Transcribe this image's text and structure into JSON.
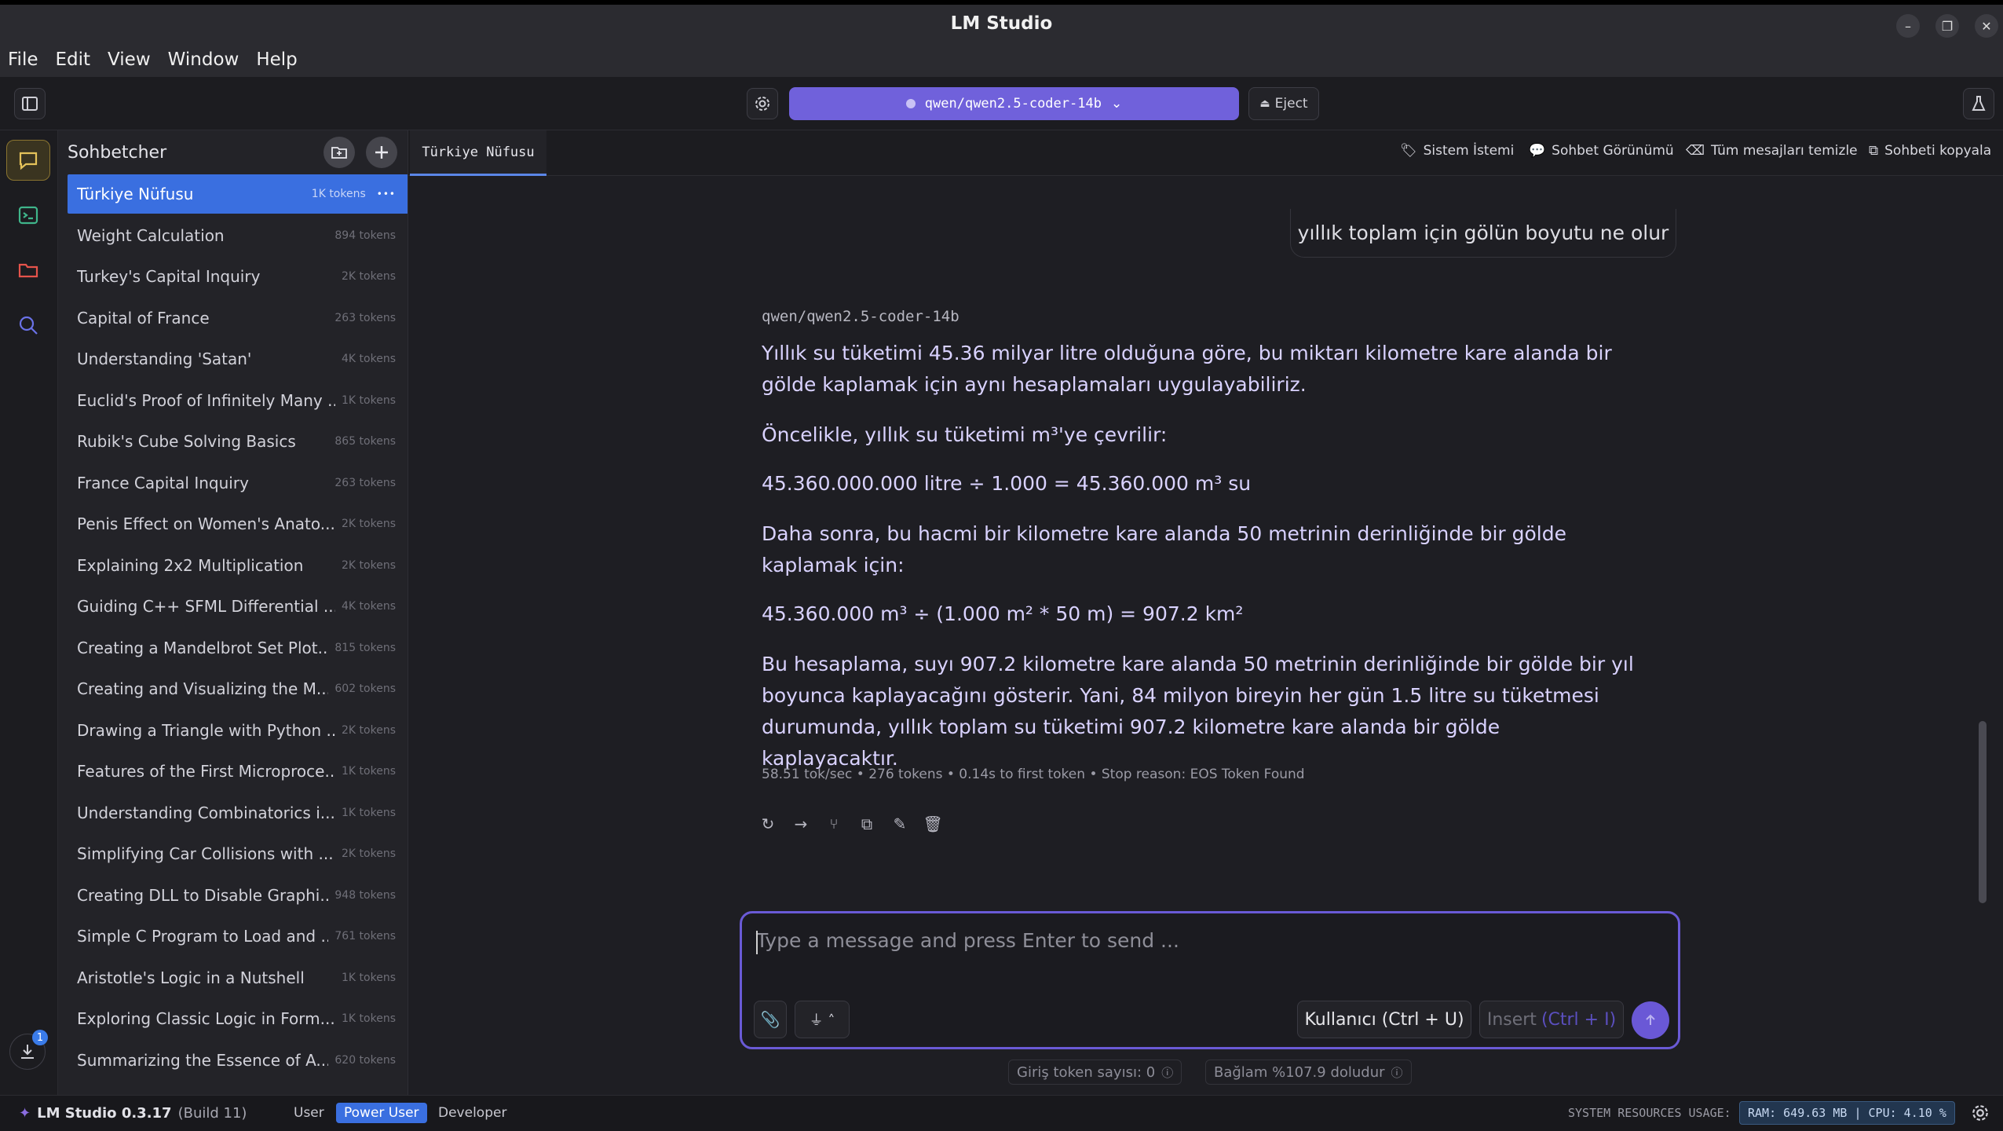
{
  "window": {
    "title": "LM Studio"
  },
  "menu": [
    "File",
    "Edit",
    "View",
    "Window",
    "Help"
  ],
  "toolbar": {
    "model": "qwen/qwen2.5-coder-14b",
    "eject_label": "Eject"
  },
  "sidebar": {
    "title": "Sohbetcher",
    "chats": [
      {
        "name": "Türkiye Nüfusu",
        "tokens": "1K tokens",
        "active": true
      },
      {
        "name": "Weight Calculation",
        "tokens": "894 tokens"
      },
      {
        "name": "Turkey's Capital Inquiry",
        "tokens": "2K tokens"
      },
      {
        "name": "Capital of France",
        "tokens": "263 tokens"
      },
      {
        "name": "Understanding 'Satan'",
        "tokens": "4K tokens"
      },
      {
        "name": "Euclid's Proof of Infinitely Many ...",
        "tokens": "1K tokens"
      },
      {
        "name": "Rubik's Cube Solving Basics",
        "tokens": "865 tokens"
      },
      {
        "name": "France Capital Inquiry",
        "tokens": "263 tokens"
      },
      {
        "name": "Penis Effect on Women's Anato...",
        "tokens": "2K tokens"
      },
      {
        "name": "Explaining 2x2 Multiplication",
        "tokens": "2K tokens"
      },
      {
        "name": "Guiding C++ SFML Differential ...",
        "tokens": "4K tokens"
      },
      {
        "name": "Creating a Mandelbrot Set Plot...",
        "tokens": "815 tokens"
      },
      {
        "name": "Creating and Visualizing the M...",
        "tokens": "602 tokens"
      },
      {
        "name": "Drawing a Triangle with Python ...",
        "tokens": "2K tokens"
      },
      {
        "name": "Features of the First Microproce...",
        "tokens": "1K tokens"
      },
      {
        "name": "Understanding Combinatorics i...",
        "tokens": "1K tokens"
      },
      {
        "name": "Simplifying Car Collisions with ...",
        "tokens": "2K tokens"
      },
      {
        "name": "Creating DLL to Disable Graphi...",
        "tokens": "948 tokens"
      },
      {
        "name": "Simple C Program to Load and ...",
        "tokens": "761 tokens"
      },
      {
        "name": "Aristotle's Logic in a Nutshell",
        "tokens": "1K tokens"
      },
      {
        "name": "Exploring Classic Logic in Form...",
        "tokens": "1K tokens"
      },
      {
        "name": "Summarizing the Essence of A...",
        "tokens": "620 tokens"
      }
    ]
  },
  "tabs": {
    "active": "Türkiye Nüfusu"
  },
  "tab_actions": {
    "system_prompt": "Sistem İstemi",
    "chat_view": "Sohbet Görünümü",
    "clear_all": "Tüm mesajları temizle",
    "copy_chat": "Sohbeti kopyala"
  },
  "conversation": {
    "user_message": "yıllık toplam için gölün boyutu ne olur",
    "model_tag": "qwen/qwen2.5-coder-14b",
    "paragraphs": [
      "Yıllık su tüketimi 45.36 milyar litre olduğuna göre, bu miktarı kilometre kare alanda bir gölde kaplamak için aynı hesaplamaları uygulayabiliriz.",
      "Öncelikle, yıllık su tüketimi m³'ye çevrilir:",
      "45.360.000.000 litre ÷ 1.000 = 45.360.000 m³ su",
      "Daha sonra, bu hacmi bir kilometre kare alanda 50 metrinin derinliğinde bir gölde kaplamak için:",
      "45.360.000 m³ ÷ (1.000 m² * 50 m) = 907.2 km²",
      "Bu hesaplama, suyı 907.2 kilometre kare alanda 50 metrinin derinliğinde bir gölde bir yıl boyunca kaplayacağını gösterir. Yani, 84 milyon bireyin her gün 1.5 litre su tüketmesi durumunda, yıllık toplam su tüketimi 907.2 kilometre kare alanda bir gölde kaplayacaktır."
    ],
    "stats": "58.51 tok/sec • 276 tokens • 0.14s to first token • Stop reason: EOS Token Found"
  },
  "composer": {
    "placeholder": "Type a message and press Enter to send ...",
    "role_label": "Kullanıcı (Ctrl + U)",
    "insert_label": "Insert",
    "insert_shortcut": "(Ctrl + I)",
    "input_tokens": "Giriş token sayısı:  0",
    "context": "Bağlam %107.9 doludur"
  },
  "status": {
    "app_name": "LM Studio 0.3.17",
    "build": "(Build 11)",
    "modes": [
      "User",
      "Power User",
      "Developer"
    ],
    "active_mode": "Power User",
    "resources_label": "SYSTEM RESOURCES USAGE:",
    "resources": "RAM: 649.63 MB | CPU: 4.10 %",
    "download_badge": "1"
  },
  "colors": {
    "accent": "#7061db",
    "active_item": "#3a6fe0",
    "assistant_text": "#d9d2ff"
  }
}
